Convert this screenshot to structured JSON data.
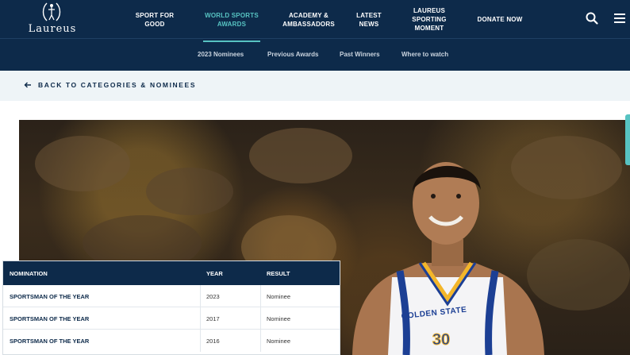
{
  "brand": {
    "name": "Laureus"
  },
  "nav": {
    "items": [
      {
        "label": "SPORT FOR\nGOOD"
      },
      {
        "label": "WORLD SPORTS\nAWARDS"
      },
      {
        "label": "ACADEMY &\nAMBASSADORS"
      },
      {
        "label": "LATEST\nNEWS"
      },
      {
        "label": "LAUREUS\nSPORTING\nMOMENT"
      },
      {
        "label": "DONATE NOW"
      }
    ],
    "active_index": 1
  },
  "subnav": {
    "items": [
      "2023 Nominees",
      "Previous Awards",
      "Past Winners",
      "Where to watch"
    ]
  },
  "back": {
    "label": "BACK TO CATEGORIES & NOMINEES"
  },
  "hero": {
    "jersey_team": "GOLDEN STATE",
    "jersey_number": "30"
  },
  "table": {
    "headers": [
      "NOMINATION",
      "YEAR",
      "RESULT"
    ],
    "rows": [
      {
        "nomination": "SPORTSMAN OF THE YEAR",
        "year": "2023",
        "result": "Nominee"
      },
      {
        "nomination": "SPORTSMAN OF THE YEAR",
        "year": "2017",
        "result": "Nominee"
      },
      {
        "nomination": "SPORTSMAN OF THE YEAR",
        "year": "2016",
        "result": "Nominee"
      }
    ]
  },
  "colors": {
    "navy": "#0d2a4a",
    "accent": "#57c3c2",
    "light_bg": "#eef4f7"
  },
  "icons": {
    "search": "search-icon",
    "menu": "hamburger-menu-icon",
    "back": "arrow-left-icon",
    "logo": "laurel-figure-icon"
  }
}
